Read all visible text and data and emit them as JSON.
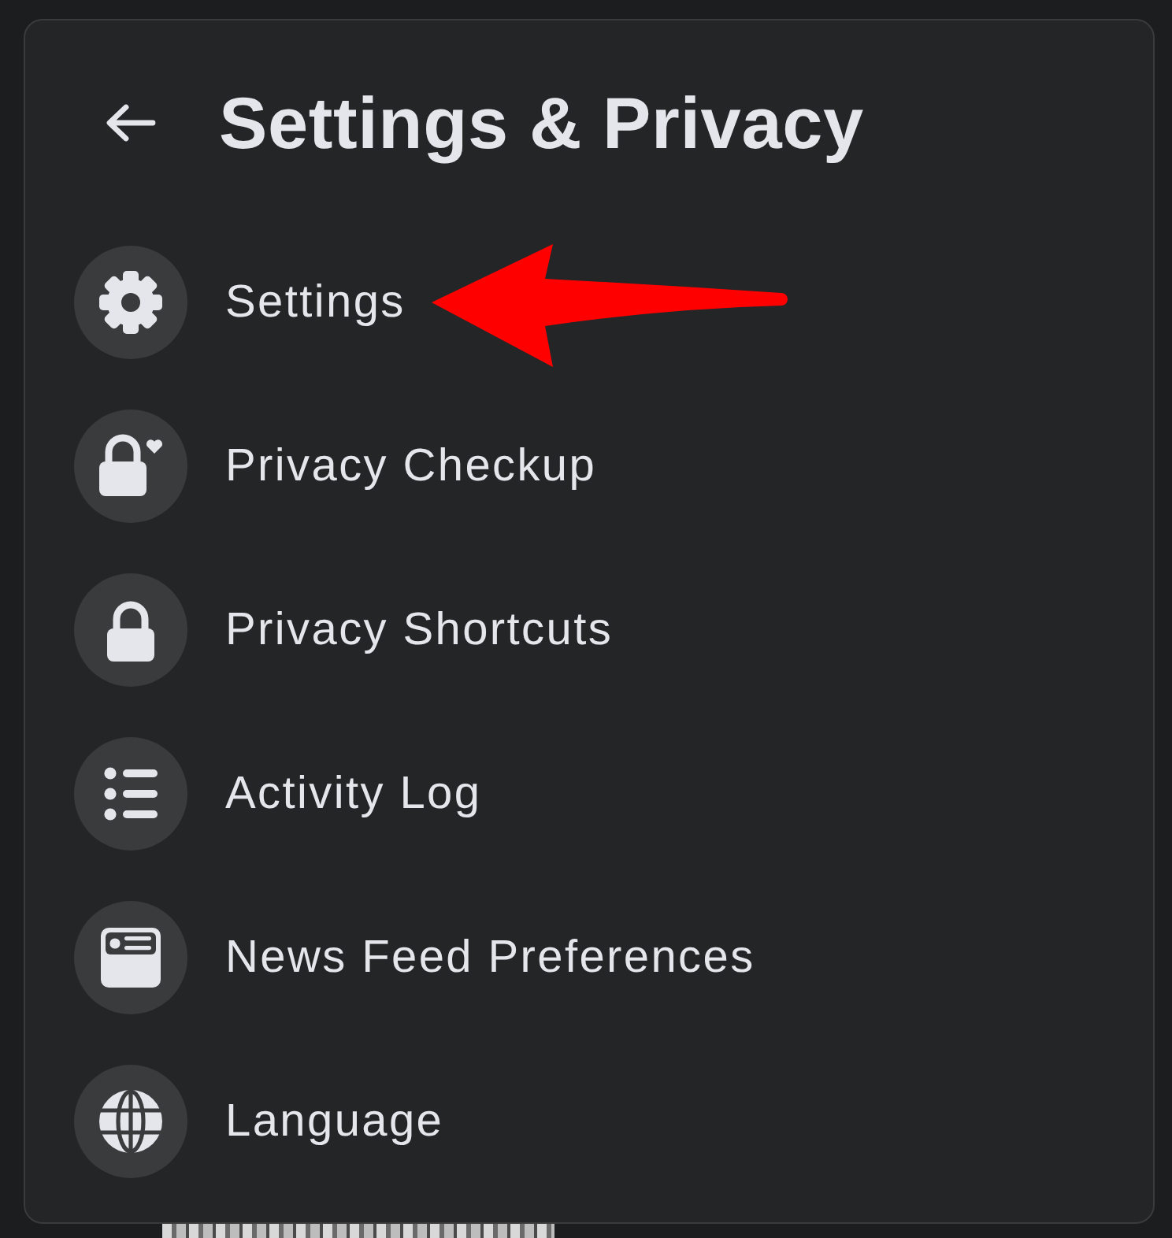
{
  "header": {
    "title": "Settings & Privacy"
  },
  "items": [
    {
      "label": "Settings",
      "pointed": true
    },
    {
      "label": "Privacy Checkup",
      "pointed": false
    },
    {
      "label": "Privacy Shortcuts",
      "pointed": false
    },
    {
      "label": "Activity Log",
      "pointed": false
    },
    {
      "label": "News Feed Preferences",
      "pointed": false
    },
    {
      "label": "Language",
      "pointed": false
    }
  ]
}
